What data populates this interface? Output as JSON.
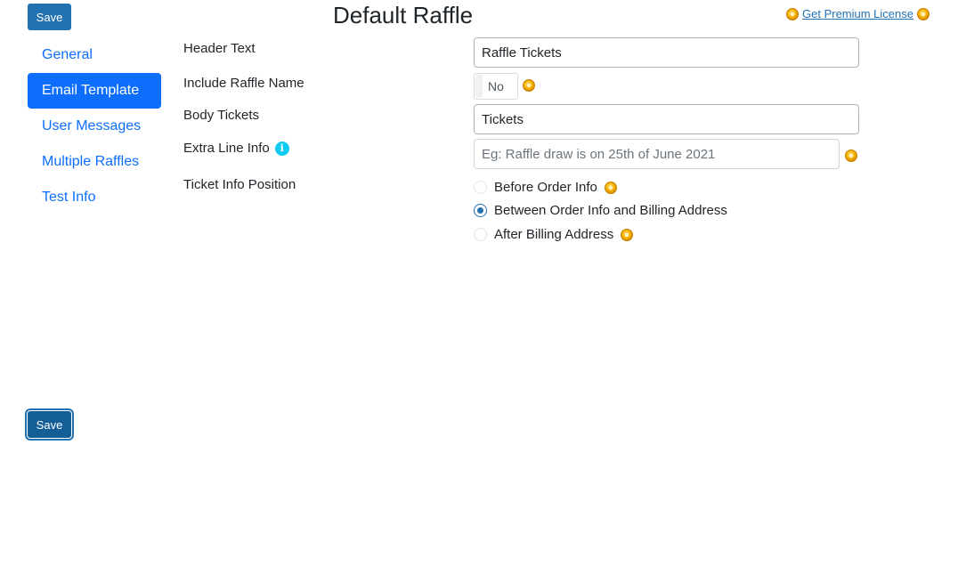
{
  "toolbar": {
    "save_label": "Save",
    "save_bottom_label": "Save"
  },
  "header": {
    "title": "Default Raffle"
  },
  "premium": {
    "link_text": "Get Premium License"
  },
  "nav": {
    "items": [
      {
        "label": "General",
        "active": false
      },
      {
        "label": "Email Template",
        "active": true
      },
      {
        "label": "User Messages",
        "active": false
      },
      {
        "label": "Multiple Raffles",
        "active": false
      },
      {
        "label": "Test Info",
        "active": false
      }
    ]
  },
  "form": {
    "header_text": {
      "label": "Header Text",
      "value": "Raffle Tickets"
    },
    "include_raffle_name": {
      "label": "Include Raffle Name",
      "value": "No"
    },
    "body_tickets": {
      "label": "Body Tickets",
      "value": "Tickets"
    },
    "extra_line_info": {
      "label": "Extra Line Info",
      "value": "",
      "placeholder": "Eg: Raffle draw is on 25th of June 2021"
    },
    "ticket_info_position": {
      "label": "Ticket Info Position",
      "options": [
        {
          "label": "Before Order Info",
          "checked": false
        },
        {
          "label": "Between Order Info and Billing Address",
          "checked": true
        },
        {
          "label": "After Billing Address",
          "checked": false
        }
      ]
    }
  },
  "colors": {
    "primary": "#0d6efd",
    "wp_blue": "#2271b1",
    "info": "#0dcaf0",
    "premium_coin": "#f5b400"
  },
  "icons": {
    "premium": "premium-coin-icon",
    "info": "info-icon"
  }
}
